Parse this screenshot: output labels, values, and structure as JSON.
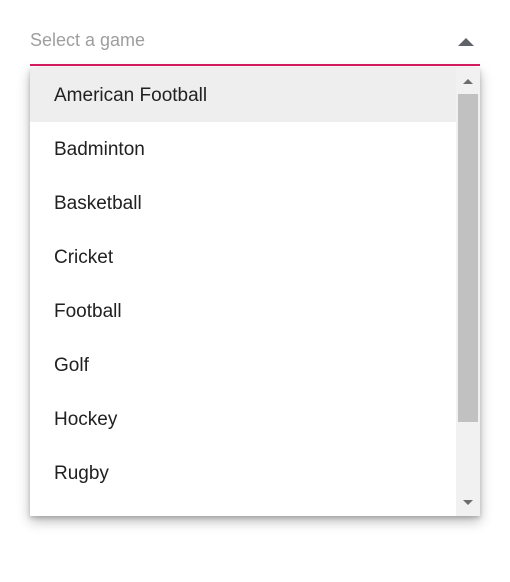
{
  "dropdown": {
    "placeholder": "Select a game",
    "accent_color": "#d81b60",
    "caret_icon": "caret-up-icon"
  },
  "list": {
    "items": [
      {
        "label": "American Football",
        "active": true
      },
      {
        "label": "Badminton"
      },
      {
        "label": "Basketball"
      },
      {
        "label": "Cricket"
      },
      {
        "label": "Football"
      },
      {
        "label": "Golf"
      },
      {
        "label": "Hockey"
      },
      {
        "label": "Rugby"
      }
    ]
  },
  "scrollbar": {
    "up_icon": "scroll-up-arrow-icon",
    "down_icon": "scroll-down-arrow-icon"
  }
}
